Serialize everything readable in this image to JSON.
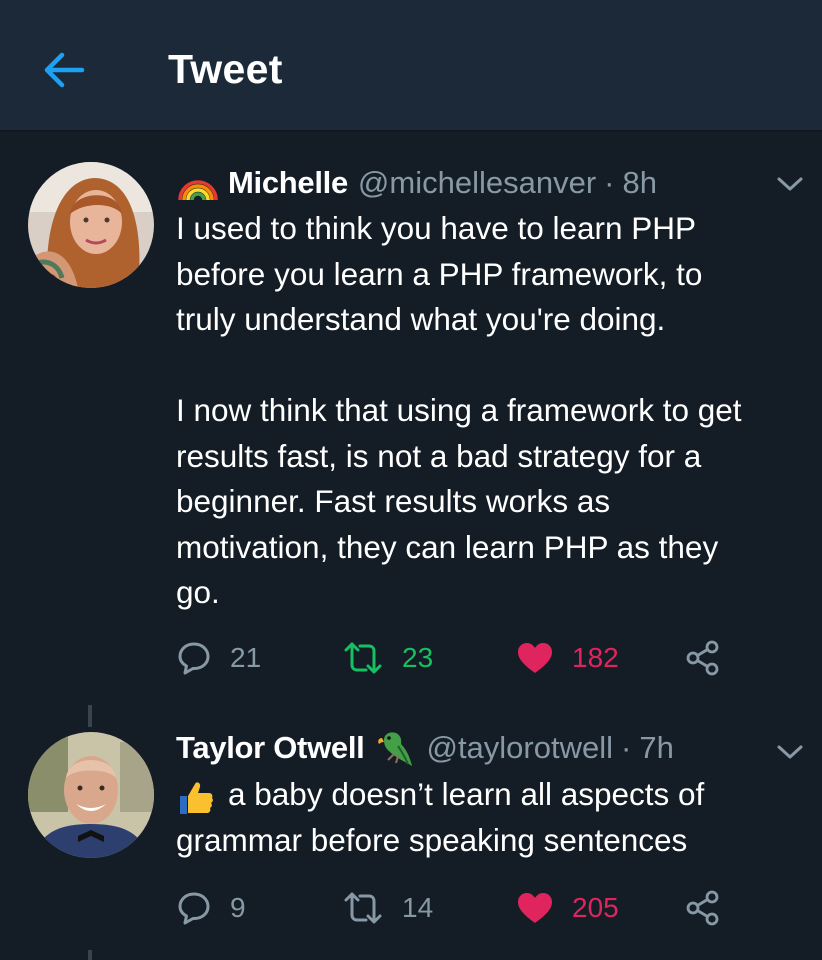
{
  "header": {
    "title": "Tweet"
  },
  "tweets": [
    {
      "name": "Michelle",
      "handle": "@michellesanver",
      "separator": "·",
      "time": "8h",
      "text": "I used to think you have to learn PHP\nbefore you learn a PHP framework, to\ntruly understand what you're doing.\n\nI now think that using a framework to get\nresults fast, is not a bad strategy for a\nbeginner. Fast results works as\nmotivation, they can learn PHP as they\ngo.",
      "replies": "21",
      "retweets": "23",
      "likes": "182"
    },
    {
      "name": "Taylor Otwell",
      "handle": "@taylorotwell",
      "separator": "·",
      "time": "7h",
      "text": "a baby doesn’t learn all aspects of\ngrammar before speaking sentences",
      "replies": "9",
      "retweets": "14",
      "likes": "205"
    }
  ],
  "colors": {
    "background": "#141d26",
    "header": "#1c2938",
    "accent": "#1da1f2",
    "muted": "#8899a6",
    "retweet_active": "#17bf63",
    "like": "#e0245e"
  },
  "icons": [
    "back-arrow-icon",
    "rainbow-icon",
    "parrot-icon",
    "thumbs-up-icon",
    "chevron-down-icon",
    "reply-icon",
    "retweet-icon",
    "heart-icon",
    "share-icon"
  ]
}
